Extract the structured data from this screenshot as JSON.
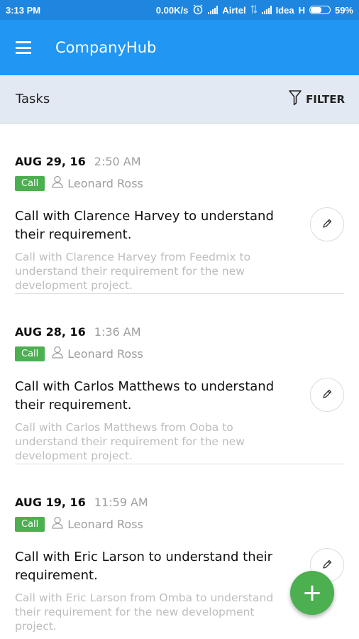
{
  "status_bar": {
    "time": "3:13 PM",
    "speed": "0.00K/s",
    "carrier1": "Airtel",
    "carrier2": "Idea",
    "network": "H",
    "battery": "59%",
    "battery_level": 0.59,
    "icons": [
      "alarm-icon",
      "signal-icon",
      "data-arrows-icon",
      "signal-icon",
      "battery-icon"
    ]
  },
  "app_bar": {
    "title": "CompanyHub",
    "menu_icon": "hamburger-menu-icon"
  },
  "sub_bar": {
    "label": "Tasks",
    "filter_label": "FILTER",
    "filter_icon": "funnel-icon"
  },
  "tasks": [
    {
      "date": "AUG 29, 16",
      "time": "2:50 AM",
      "type": "Call",
      "owner": "Leonard Ross",
      "title": "Call with Clarence Harvey to understand their requirement.",
      "description": "Call with Clarence Harvey from Feedmix to understand their requirement for the new development project."
    },
    {
      "date": "AUG 28, 16",
      "time": "1:36 AM",
      "type": "Call",
      "owner": "Leonard Ross",
      "title": "Call with Carlos Matthews to understand their requirement.",
      "description": "Call with Carlos Matthews from Ooba to understand their requirement for the new development project."
    },
    {
      "date": "AUG 19, 16",
      "time": "11:59 AM",
      "type": "Call",
      "owner": "Leonard Ross",
      "title": "Call with Eric Larson to understand their requirement.",
      "description": "Call with Eric Larson from Omba to understand their requirement for the new development project."
    }
  ],
  "fab": {
    "label": "+",
    "icon": "plus-icon"
  },
  "colors": {
    "status_bar": "#1f86e0",
    "app_bar": "#2196f3",
    "sub_bar": "#e3e9f3",
    "badge": "#4caf50",
    "fab": "#4caf50"
  }
}
